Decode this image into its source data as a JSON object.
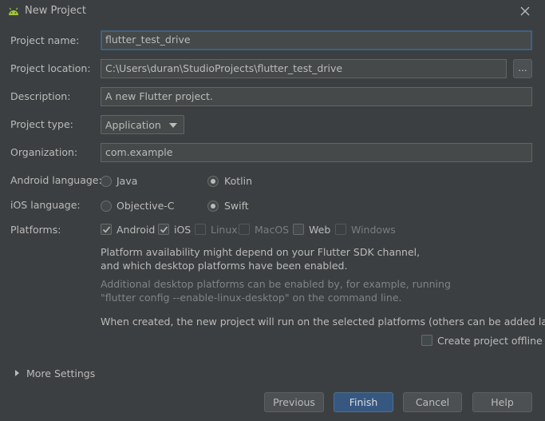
{
  "window": {
    "title": "New Project"
  },
  "form": {
    "project_name": {
      "label": "Project name:",
      "value": "flutter_test_drive"
    },
    "project_location": {
      "label": "Project location:",
      "value": "C:\\Users\\duran\\StudioProjects\\flutter_test_drive",
      "browse_label": "..."
    },
    "description": {
      "label": "Description:",
      "value": "A new Flutter project."
    },
    "project_type": {
      "label": "Project type:",
      "value": "Application"
    },
    "organization": {
      "label": "Organization:",
      "value": "com.example"
    },
    "android_language": {
      "label": "Android language:",
      "options": [
        "Java",
        "Kotlin"
      ],
      "selected": "Kotlin"
    },
    "ios_language": {
      "label": "iOS language:",
      "options": [
        "Objective-C",
        "Swift"
      ],
      "selected": "Swift"
    },
    "platforms": {
      "label": "Platforms:",
      "items": [
        {
          "label": "Android",
          "checked": true,
          "enabled": true
        },
        {
          "label": "iOS",
          "checked": true,
          "enabled": true
        },
        {
          "label": "Linux",
          "checked": false,
          "enabled": false
        },
        {
          "label": "MacOS",
          "checked": false,
          "enabled": false
        },
        {
          "label": "Web",
          "checked": false,
          "enabled": true
        },
        {
          "label": "Windows",
          "checked": false,
          "enabled": false
        }
      ]
    },
    "notes": {
      "availability_line1": "Platform availability might depend on your Flutter SDK channel,",
      "availability_line2": "and which desktop platforms have been enabled.",
      "additional_line1": "Additional desktop platforms can be enabled by, for example, running",
      "additional_line2": "\"flutter config --enable-linux-desktop\" on the command line.",
      "when_created": "When created, the new project will run on the selected platforms (others can be added later)."
    },
    "create_offline": {
      "label": "Create project offline",
      "checked": false
    },
    "more_settings": "More Settings"
  },
  "buttons": {
    "previous": "Previous",
    "finish": "Finish",
    "cancel": "Cancel",
    "help": "Help"
  },
  "colors": {
    "background": "#3c3f41",
    "field": "#45494a",
    "focus": "#3d6185",
    "primary_button": "#365880"
  },
  "icons": {
    "app": "android-icon",
    "close": "close-icon",
    "expand": "chevron-right-icon",
    "check": "checkmark-icon"
  }
}
